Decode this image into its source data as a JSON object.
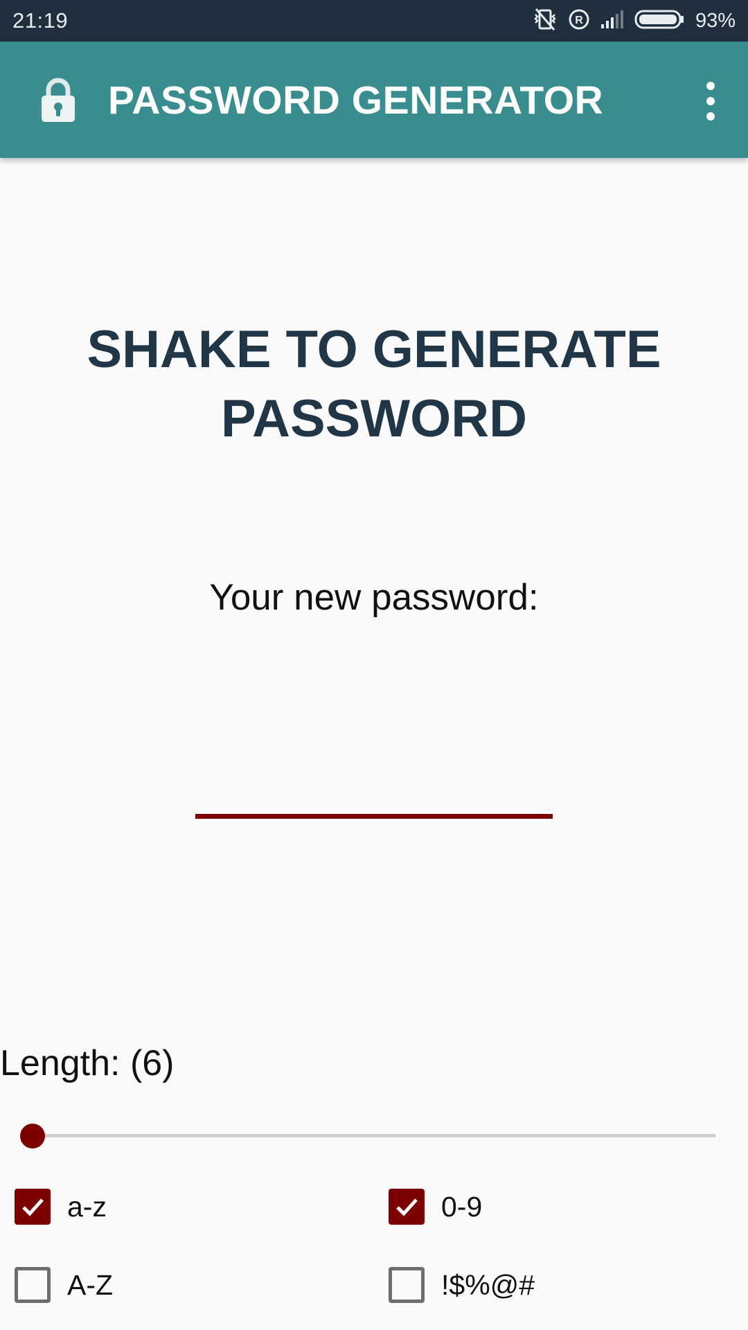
{
  "status_bar": {
    "time": "21:19",
    "battery": "93%",
    "icons": [
      "vibrate-off-icon",
      "registered-icon",
      "signal-icon",
      "battery-icon"
    ]
  },
  "app_bar": {
    "title": "PASSWORD GENERATOR",
    "icon": "lock-icon",
    "menu_icon": "overflow-menu-icon",
    "color": "#3a8d8f"
  },
  "main": {
    "headline_line1": "SHAKE TO GENERATE",
    "headline_line2": "PASSWORD",
    "password_label": "Your new password:",
    "password_value": ""
  },
  "length": {
    "label": "Length: (6)",
    "slider_fraction": 0
  },
  "options": [
    {
      "label": "a-z",
      "checked": true
    },
    {
      "label": "0-9",
      "checked": true
    },
    {
      "label": "A-Z",
      "checked": false
    },
    {
      "label": "!$%@#",
      "checked": false
    }
  ],
  "colors": {
    "accent": "#7d0000",
    "status_bar": "#1f2f3d",
    "headline": "#213646"
  }
}
